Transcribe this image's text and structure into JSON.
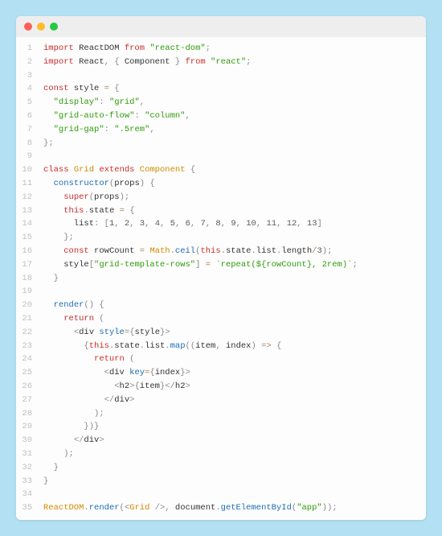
{
  "titlebar": {
    "dots": [
      "red",
      "yellow",
      "green"
    ]
  },
  "code": {
    "lines": [
      {
        "n": 1,
        "tokens": [
          [
            "kw",
            "import"
          ],
          [
            "ident",
            " ReactDOM "
          ],
          [
            "kw",
            "from"
          ],
          [
            "ident",
            " "
          ],
          [
            "str",
            "\"react-dom\""
          ],
          [
            "punc",
            ";"
          ]
        ]
      },
      {
        "n": 2,
        "tokens": [
          [
            "kw",
            "import"
          ],
          [
            "ident",
            " React"
          ],
          [
            "punc",
            ","
          ],
          [
            "ident",
            " "
          ],
          [
            "punc",
            "{"
          ],
          [
            "ident",
            " Component "
          ],
          [
            "punc",
            "}"
          ],
          [
            "ident",
            " "
          ],
          [
            "kw",
            "from"
          ],
          [
            "ident",
            " "
          ],
          [
            "str",
            "\"react\""
          ],
          [
            "punc",
            ";"
          ]
        ]
      },
      {
        "n": 3,
        "tokens": []
      },
      {
        "n": 4,
        "tokens": [
          [
            "kw",
            "const"
          ],
          [
            "ident",
            " style "
          ],
          [
            "op",
            "="
          ],
          [
            "ident",
            " "
          ],
          [
            "punc",
            "{"
          ]
        ]
      },
      {
        "n": 5,
        "tokens": [
          [
            "ident",
            "  "
          ],
          [
            "str",
            "\"display\""
          ],
          [
            "punc",
            ":"
          ],
          [
            "ident",
            " "
          ],
          [
            "str",
            "\"grid\""
          ],
          [
            "punc",
            ","
          ]
        ]
      },
      {
        "n": 6,
        "tokens": [
          [
            "ident",
            "  "
          ],
          [
            "str",
            "\"grid-auto-flow\""
          ],
          [
            "punc",
            ":"
          ],
          [
            "ident",
            " "
          ],
          [
            "str",
            "\"column\""
          ],
          [
            "punc",
            ","
          ]
        ]
      },
      {
        "n": 7,
        "tokens": [
          [
            "ident",
            "  "
          ],
          [
            "str",
            "\"grid-gap\""
          ],
          [
            "punc",
            ":"
          ],
          [
            "ident",
            " "
          ],
          [
            "str",
            "\".5rem\""
          ],
          [
            "punc",
            ","
          ]
        ]
      },
      {
        "n": 8,
        "tokens": [
          [
            "punc",
            "}"
          ],
          [
            "punc",
            ";"
          ]
        ]
      },
      {
        "n": 9,
        "tokens": []
      },
      {
        "n": 10,
        "tokens": [
          [
            "kw",
            "class"
          ],
          [
            "ident",
            " "
          ],
          [
            "class",
            "Grid"
          ],
          [
            "ident",
            " "
          ],
          [
            "kw",
            "extends"
          ],
          [
            "ident",
            " "
          ],
          [
            "class",
            "Component"
          ],
          [
            "ident",
            " "
          ],
          [
            "punc",
            "{"
          ]
        ]
      },
      {
        "n": 11,
        "tokens": [
          [
            "ident",
            "  "
          ],
          [
            "fn",
            "constructor"
          ],
          [
            "punc",
            "("
          ],
          [
            "ident",
            "props"
          ],
          [
            "punc",
            ")"
          ],
          [
            "ident",
            " "
          ],
          [
            "punc",
            "{"
          ]
        ]
      },
      {
        "n": 12,
        "tokens": [
          [
            "ident",
            "    "
          ],
          [
            "kw",
            "super"
          ],
          [
            "punc",
            "("
          ],
          [
            "ident",
            "props"
          ],
          [
            "punc",
            ")"
          ],
          [
            "punc",
            ";"
          ]
        ]
      },
      {
        "n": 13,
        "tokens": [
          [
            "ident",
            "    "
          ],
          [
            "kw",
            "this"
          ],
          [
            "punc",
            "."
          ],
          [
            "ident",
            "state "
          ],
          [
            "op",
            "="
          ],
          [
            "ident",
            " "
          ],
          [
            "punc",
            "{"
          ]
        ]
      },
      {
        "n": 14,
        "tokens": [
          [
            "ident",
            "      list"
          ],
          [
            "punc",
            ":"
          ],
          [
            "ident",
            " "
          ],
          [
            "punc",
            "["
          ],
          [
            "num",
            "1"
          ],
          [
            "punc",
            ", "
          ],
          [
            "num",
            "2"
          ],
          [
            "punc",
            ", "
          ],
          [
            "num",
            "3"
          ],
          [
            "punc",
            ", "
          ],
          [
            "num",
            "4"
          ],
          [
            "punc",
            ", "
          ],
          [
            "num",
            "5"
          ],
          [
            "punc",
            ", "
          ],
          [
            "num",
            "6"
          ],
          [
            "punc",
            ", "
          ],
          [
            "num",
            "7"
          ],
          [
            "punc",
            ", "
          ],
          [
            "num",
            "8"
          ],
          [
            "punc",
            ", "
          ],
          [
            "num",
            "9"
          ],
          [
            "punc",
            ", "
          ],
          [
            "num",
            "10"
          ],
          [
            "punc",
            ", "
          ],
          [
            "num",
            "11"
          ],
          [
            "punc",
            ", "
          ],
          [
            "num",
            "12"
          ],
          [
            "punc",
            ", "
          ],
          [
            "num",
            "13"
          ],
          [
            "punc",
            "]"
          ]
        ]
      },
      {
        "n": 15,
        "tokens": [
          [
            "ident",
            "    "
          ],
          [
            "punc",
            "}"
          ],
          [
            "punc",
            ";"
          ]
        ]
      },
      {
        "n": 16,
        "tokens": [
          [
            "ident",
            "    "
          ],
          [
            "kw",
            "const"
          ],
          [
            "ident",
            " rowCount "
          ],
          [
            "op",
            "="
          ],
          [
            "ident",
            " "
          ],
          [
            "global",
            "Math"
          ],
          [
            "punc",
            "."
          ],
          [
            "fn",
            "ceil"
          ],
          [
            "punc",
            "("
          ],
          [
            "kw",
            "this"
          ],
          [
            "punc",
            "."
          ],
          [
            "ident",
            "state"
          ],
          [
            "punc",
            "."
          ],
          [
            "ident",
            "list"
          ],
          [
            "punc",
            "."
          ],
          [
            "ident",
            "length"
          ],
          [
            "op",
            "/"
          ],
          [
            "num",
            "3"
          ],
          [
            "punc",
            ")"
          ],
          [
            "punc",
            ";"
          ]
        ]
      },
      {
        "n": 17,
        "tokens": [
          [
            "ident",
            "    style"
          ],
          [
            "punc",
            "["
          ],
          [
            "str",
            "\"grid-template-rows\""
          ],
          [
            "punc",
            "]"
          ],
          [
            "ident",
            " "
          ],
          [
            "op",
            "="
          ],
          [
            "ident",
            " "
          ],
          [
            "tmpl",
            "`repeat(${rowCount}, 2rem)`"
          ],
          [
            "punc",
            ";"
          ]
        ]
      },
      {
        "n": 18,
        "tokens": [
          [
            "ident",
            "  "
          ],
          [
            "punc",
            "}"
          ]
        ]
      },
      {
        "n": 19,
        "tokens": []
      },
      {
        "n": 20,
        "tokens": [
          [
            "ident",
            "  "
          ],
          [
            "fn",
            "render"
          ],
          [
            "punc",
            "("
          ],
          [
            "punc",
            ")"
          ],
          [
            "ident",
            " "
          ],
          [
            "punc",
            "{"
          ]
        ]
      },
      {
        "n": 21,
        "tokens": [
          [
            "ident",
            "    "
          ],
          [
            "kw",
            "return"
          ],
          [
            "ident",
            " "
          ],
          [
            "punc",
            "("
          ]
        ]
      },
      {
        "n": 22,
        "tokens": [
          [
            "ident",
            "      "
          ],
          [
            "punc",
            "<"
          ],
          [
            "ident",
            "div "
          ],
          [
            "fn",
            "style"
          ],
          [
            "op",
            "="
          ],
          [
            "punc",
            "{"
          ],
          [
            "ident",
            "style"
          ],
          [
            "punc",
            "}"
          ],
          [
            "punc",
            ">"
          ]
        ]
      },
      {
        "n": 23,
        "tokens": [
          [
            "ident",
            "        "
          ],
          [
            "punc",
            "{"
          ],
          [
            "kw",
            "this"
          ],
          [
            "punc",
            "."
          ],
          [
            "ident",
            "state"
          ],
          [
            "punc",
            "."
          ],
          [
            "ident",
            "list"
          ],
          [
            "punc",
            "."
          ],
          [
            "fn",
            "map"
          ],
          [
            "punc",
            "(("
          ],
          [
            "ident",
            "item"
          ],
          [
            "punc",
            ","
          ],
          [
            "ident",
            " index"
          ],
          [
            "punc",
            ")"
          ],
          [
            "ident",
            " "
          ],
          [
            "op",
            "=>"
          ],
          [
            "ident",
            " "
          ],
          [
            "punc",
            "{"
          ]
        ]
      },
      {
        "n": 24,
        "tokens": [
          [
            "ident",
            "          "
          ],
          [
            "kw",
            "return"
          ],
          [
            "ident",
            " "
          ],
          [
            "punc",
            "("
          ]
        ]
      },
      {
        "n": 25,
        "tokens": [
          [
            "ident",
            "            "
          ],
          [
            "punc",
            "<"
          ],
          [
            "ident",
            "div "
          ],
          [
            "fn",
            "key"
          ],
          [
            "op",
            "="
          ],
          [
            "punc",
            "{"
          ],
          [
            "ident",
            "index"
          ],
          [
            "punc",
            "}"
          ],
          [
            "punc",
            ">"
          ]
        ]
      },
      {
        "n": 26,
        "tokens": [
          [
            "ident",
            "              "
          ],
          [
            "punc",
            "<"
          ],
          [
            "ident",
            "h2"
          ],
          [
            "punc",
            ">"
          ],
          [
            "punc",
            "{"
          ],
          [
            "ident",
            "item"
          ],
          [
            "punc",
            "}"
          ],
          [
            "punc",
            "</"
          ],
          [
            "ident",
            "h2"
          ],
          [
            "punc",
            ">"
          ]
        ]
      },
      {
        "n": 27,
        "tokens": [
          [
            "ident",
            "            "
          ],
          [
            "punc",
            "</"
          ],
          [
            "ident",
            "div"
          ],
          [
            "punc",
            ">"
          ]
        ]
      },
      {
        "n": 28,
        "tokens": [
          [
            "ident",
            "          "
          ],
          [
            "punc",
            ")"
          ],
          [
            "punc",
            ";"
          ]
        ]
      },
      {
        "n": 29,
        "tokens": [
          [
            "ident",
            "        "
          ],
          [
            "punc",
            "}"
          ],
          [
            "punc",
            ")"
          ],
          [
            "punc",
            "}"
          ]
        ]
      },
      {
        "n": 30,
        "tokens": [
          [
            "ident",
            "      "
          ],
          [
            "punc",
            "</"
          ],
          [
            "ident",
            "div"
          ],
          [
            "punc",
            ">"
          ]
        ]
      },
      {
        "n": 31,
        "tokens": [
          [
            "ident",
            "    "
          ],
          [
            "punc",
            ")"
          ],
          [
            "punc",
            ";"
          ]
        ]
      },
      {
        "n": 32,
        "tokens": [
          [
            "ident",
            "  "
          ],
          [
            "punc",
            "}"
          ]
        ]
      },
      {
        "n": 33,
        "tokens": [
          [
            "punc",
            "}"
          ]
        ]
      },
      {
        "n": 34,
        "tokens": []
      },
      {
        "n": 35,
        "tokens": [
          [
            "global",
            "ReactDOM"
          ],
          [
            "punc",
            "."
          ],
          [
            "fn",
            "render"
          ],
          [
            "punc",
            "("
          ],
          [
            "punc",
            "<"
          ],
          [
            "class",
            "Grid"
          ],
          [
            "ident",
            " "
          ],
          [
            "punc",
            "/>"
          ],
          [
            "punc",
            ","
          ],
          [
            "ident",
            " document"
          ],
          [
            "punc",
            "."
          ],
          [
            "fn",
            "getElementById"
          ],
          [
            "punc",
            "("
          ],
          [
            "str",
            "\"app\""
          ],
          [
            "punc",
            ")"
          ],
          [
            "punc",
            ")"
          ],
          [
            "punc",
            ";"
          ]
        ]
      }
    ]
  }
}
